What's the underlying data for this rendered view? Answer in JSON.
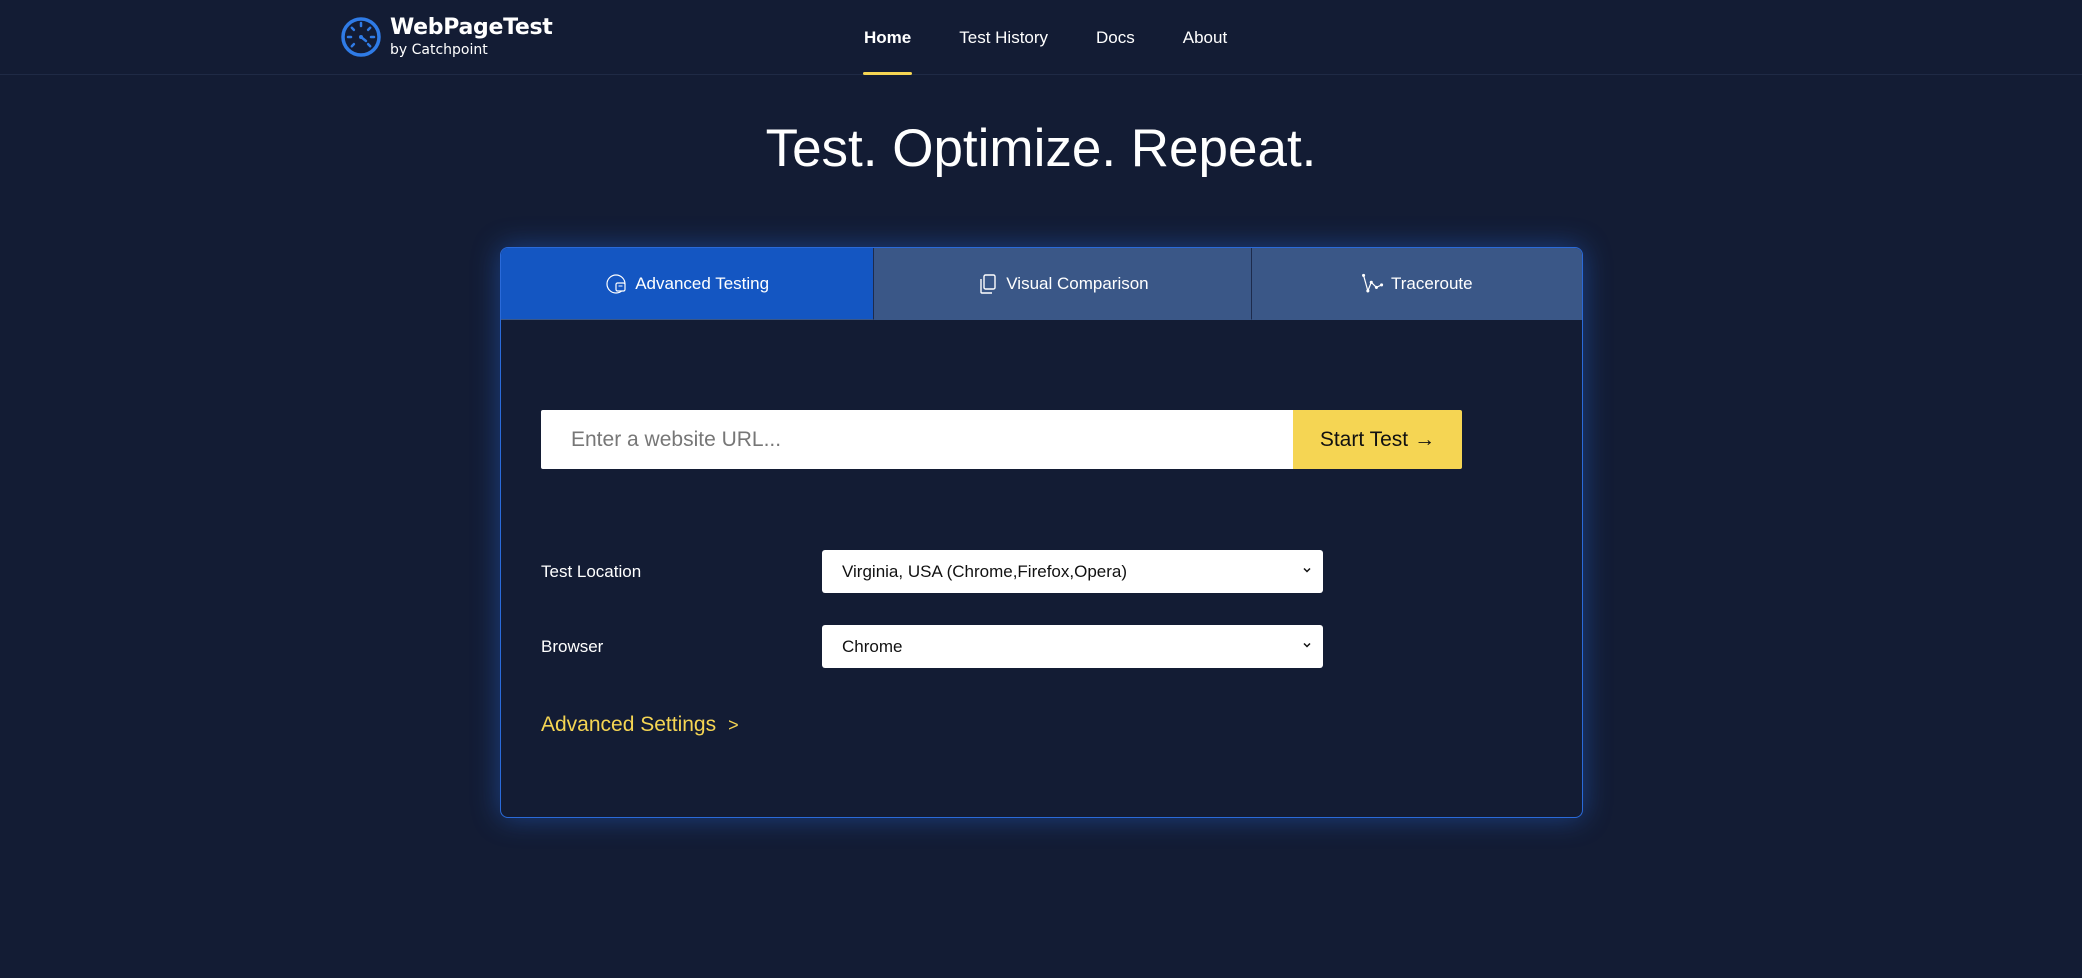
{
  "brand": {
    "title": "WebPageTest",
    "subtitle": "by Catchpoint",
    "accent": "#f5d553",
    "logo_color": "#2f7be6"
  },
  "nav": {
    "items": [
      {
        "label": "Home",
        "active": true
      },
      {
        "label": "Test History",
        "active": false
      },
      {
        "label": "Docs",
        "active": false
      },
      {
        "label": "About",
        "active": false
      }
    ]
  },
  "hero": {
    "title": "Test. Optimize. Repeat."
  },
  "tabs": [
    {
      "label": "Advanced Testing",
      "icon": "gauge-icon",
      "active": true
    },
    {
      "label": "Visual Comparison",
      "icon": "copy-pages-icon",
      "active": false
    },
    {
      "label": "Traceroute",
      "icon": "traceroute-icon",
      "active": false
    }
  ],
  "url_form": {
    "placeholder": "Enter a website URL...",
    "value": "",
    "button_label": "Start Test",
    "button_arrow": "→"
  },
  "settings": {
    "location": {
      "label": "Test Location",
      "value": "Virginia, USA (Chrome,Firefox,Opera)"
    },
    "browser": {
      "label": "Browser",
      "value": "Chrome"
    }
  },
  "advanced": {
    "label": "Advanced Settings",
    "arrow": ">"
  }
}
